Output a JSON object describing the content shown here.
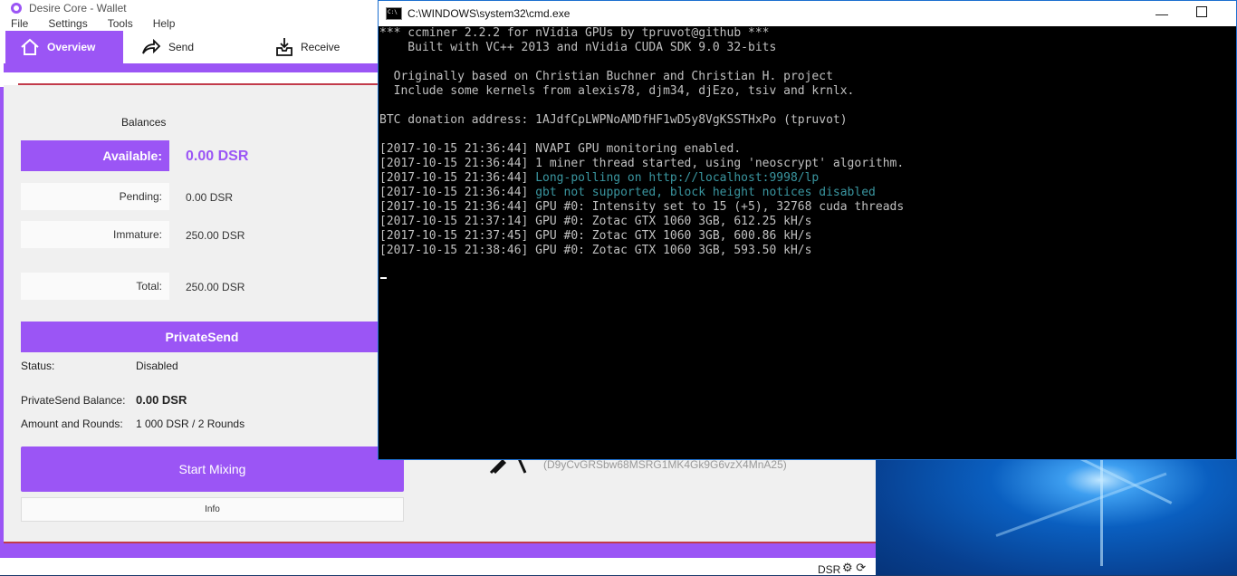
{
  "wallet": {
    "title": "Desire Core - Wallet",
    "menu": [
      "File",
      "Settings",
      "Tools",
      "Help"
    ],
    "tabs": {
      "overview": "Overview",
      "send": "Send",
      "receive": "Receive"
    },
    "balances": {
      "title": "Balances",
      "available_label": "Available:",
      "available_value": "0.00 DSR",
      "pending_label": "Pending:",
      "pending_value": "0.00 DSR",
      "immature_label": "Immature:",
      "immature_value": "250.00 DSR",
      "total_label": "Total:",
      "total_value": "250.00 DSR"
    },
    "privatesend": {
      "title": "PrivateSend",
      "status_label": "Status:",
      "status_value": "Disabled",
      "balance_label": "PrivateSend Balance:",
      "balance_value": "0.00 DSR",
      "amount_label": "Amount and Rounds:",
      "amount_value": "1 000 DSR / 2 Rounds",
      "start_button": "Start Mixing",
      "info_button": "Info"
    },
    "address_fragment": "(D9yCvGRSbw68MSRG1MK4Gk9G6vzX4MnA25)",
    "status_unit": "DSR",
    "accent_color": "#9b55f5"
  },
  "cmd": {
    "title": "C:\\WINDOWS\\system32\\cmd.exe",
    "lines": [
      {
        "text": "*** ccminer 2.2.2 for nVidia GPUs by tpruvot@github ***",
        "color": "gray"
      },
      {
        "text": "    Built with VC++ 2013 and nVidia CUDA SDK 9.0 32-bits",
        "color": "gray"
      },
      {
        "text": "",
        "color": "gray"
      },
      {
        "text": "  Originally based on Christian Buchner and Christian H. project",
        "color": "gray"
      },
      {
        "text": "  Include some kernels from alexis78, djm34, djEzo, tsiv and krnlx.",
        "color": "gray"
      },
      {
        "text": "",
        "color": "gray"
      },
      {
        "text": "BTC donation address: 1AJdfCpLWPNoAMDfHF1wD5y8VgKSSTHxPo (tpruvot)",
        "color": "gray"
      },
      {
        "text": "",
        "color": "gray"
      },
      {
        "text": "[2017-10-15 21:36:44] NVAPI GPU monitoring enabled.",
        "color": "gray"
      },
      {
        "text": "[2017-10-15 21:36:44] 1 miner thread started, using 'neoscrypt' algorithm.",
        "color": "gray"
      },
      {
        "text": "[2017-10-15 21:36:44] ",
        "color": "gray",
        "tail": "Long-polling on http://localhost:9998/lp"
      },
      {
        "text": "[2017-10-15 21:36:44] ",
        "color": "gray",
        "tail": "gbt not supported, block height notices disabled"
      },
      {
        "text": "[2017-10-15 21:36:44] GPU #0: Intensity set to 15 (+5), 32768 cuda threads",
        "color": "gray"
      },
      {
        "text": "[2017-10-15 21:37:14] GPU #0: Zotac GTX 1060 3GB, 612.25 kH/s",
        "color": "gray"
      },
      {
        "text": "[2017-10-15 21:37:45] GPU #0: Zotac GTX 1060 3GB, 600.86 kH/s",
        "color": "gray"
      },
      {
        "text": "[2017-10-15 21:38:46] GPU #0: Zotac GTX 1060 3GB, 593.50 kH/s",
        "color": "gray"
      }
    ]
  }
}
